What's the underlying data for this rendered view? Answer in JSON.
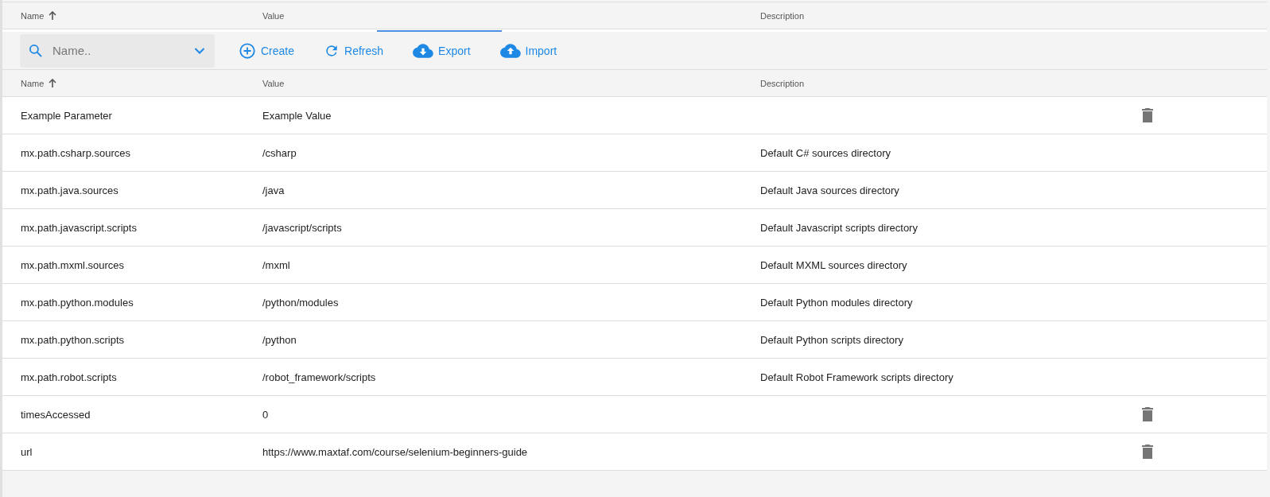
{
  "top_header": {
    "columns": [
      {
        "label": "Name",
        "sorted": true
      },
      {
        "label": "Value",
        "sorted": false
      },
      {
        "label": "Description",
        "sorted": false
      }
    ]
  },
  "toolbar": {
    "search": {
      "placeholder": "Name.."
    },
    "actions": [
      {
        "kind": "create",
        "label": "Create"
      },
      {
        "kind": "refresh",
        "label": "Refresh"
      },
      {
        "kind": "export",
        "label": "Export"
      },
      {
        "kind": "import",
        "label": "Import"
      }
    ]
  },
  "table": {
    "columns": [
      {
        "label": "Name",
        "sorted": true
      },
      {
        "label": "Value",
        "sorted": false
      },
      {
        "label": "Description",
        "sorted": false
      }
    ],
    "rows": [
      {
        "name": "Example Parameter",
        "value": "Example Value",
        "description": "",
        "deletable": true
      },
      {
        "name": "mx.path.csharp.sources",
        "value": "/csharp",
        "description": "Default C# sources directory",
        "deletable": false
      },
      {
        "name": "mx.path.java.sources",
        "value": "/java",
        "description": "Default Java sources directory",
        "deletable": false
      },
      {
        "name": "mx.path.javascript.scripts",
        "value": "/javascript/scripts",
        "description": "Default Javascript scripts directory",
        "deletable": false
      },
      {
        "name": "mx.path.mxml.sources",
        "value": "/mxml",
        "description": "Default MXML sources directory",
        "deletable": false
      },
      {
        "name": "mx.path.python.modules",
        "value": "/python/modules",
        "description": "Default Python modules directory",
        "deletable": false
      },
      {
        "name": "mx.path.python.scripts",
        "value": "/python",
        "description": "Default Python scripts directory",
        "deletable": false
      },
      {
        "name": "mx.path.robot.scripts",
        "value": "/robot_framework/scripts",
        "description": "Default Robot Framework scripts directory",
        "deletable": false
      },
      {
        "name": "timesAccessed",
        "value": "0",
        "description": "",
        "deletable": true
      },
      {
        "name": "url",
        "value": "https://www.maxtaf.com/course/selenium-beginners-guide",
        "description": "",
        "deletable": true
      }
    ]
  }
}
